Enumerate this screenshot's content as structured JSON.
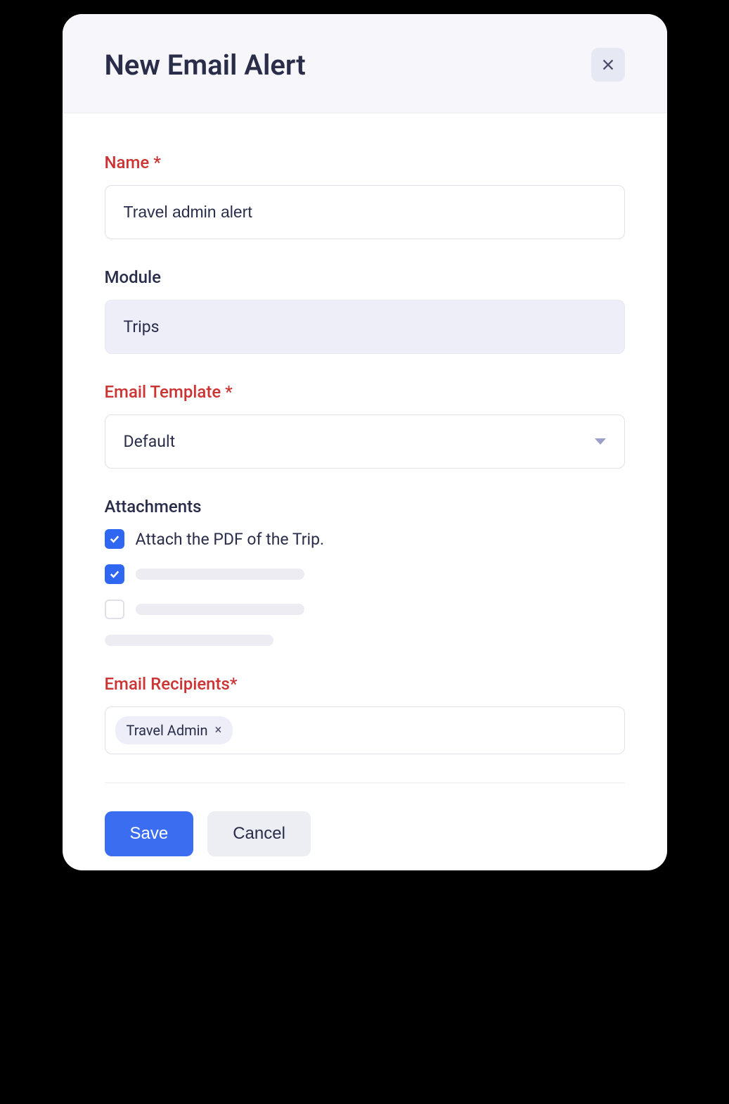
{
  "header": {
    "title": "New Email Alert"
  },
  "form": {
    "name": {
      "label": "Name *",
      "value": "Travel admin alert"
    },
    "module": {
      "label": "Module",
      "value": "Trips"
    },
    "email_template": {
      "label": "Email Template *",
      "value": "Default"
    },
    "attachments": {
      "label": "Attachments",
      "items": [
        {
          "checked": true,
          "label": "Attach the PDF of the Trip."
        }
      ]
    },
    "recipients": {
      "label": "Email Recipients*",
      "chips": [
        "Travel Admin"
      ]
    }
  },
  "buttons": {
    "save": "Save",
    "cancel": "Cancel"
  }
}
